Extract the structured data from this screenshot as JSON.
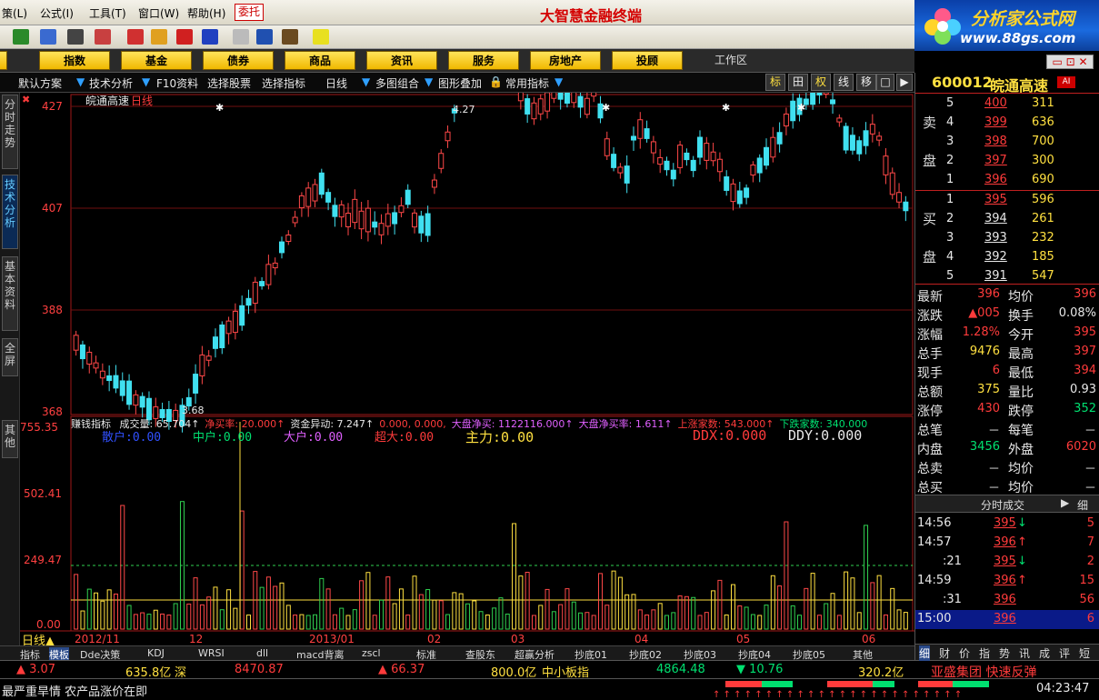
{
  "menus": [
    "策(L)",
    "公式(I)",
    "工具(T)",
    "窗口(W)",
    "帮助(H)"
  ],
  "weituo": "委托",
  "app_title": "大智慧金融终端",
  "logo": {
    "line1": "分析家公式网",
    "line2": "www.88gs.com"
  },
  "categories": [
    "票",
    "指数",
    "基金",
    "债券",
    "商品",
    "资讯",
    "服务",
    "房地产",
    "投顾"
  ],
  "workarea": "工作区",
  "controls": [
    "默认方案",
    "技术分析",
    "F10资料",
    "选择股票",
    "选择指标",
    "日线",
    "多图组合",
    "图形叠加",
    "常用指标"
  ],
  "ctrl_buttons": [
    "标",
    "田",
    "权",
    "线",
    "移",
    "□",
    "▶"
  ],
  "side_tabs": [
    "分时走势",
    "技术分析",
    "基本资料",
    "全屏",
    "其他"
  ],
  "chart": {
    "stock": "皖通高速",
    "period": "日线",
    "price_labels": [
      "427",
      "407",
      "388",
      "368"
    ],
    "high_mark": "4.27",
    "low_mark": "3.68",
    "ind_name": "赚钱指标",
    "ind_items": [
      {
        "t": "成交量: 65.704↑",
        "c": "#e8e8e8"
      },
      {
        "t": "净买率: 20.000↑",
        "c": "#ff3b3b"
      },
      {
        "t": "资金异动: 7.247↑",
        "c": "#e8e8e8"
      },
      {
        "t": "0.000, 0.000,",
        "c": "#ff3b3b"
      },
      {
        "t": "大盘净买: 1122116.000↑",
        "c": "#e060ff"
      },
      {
        "t": "大盘净买率: 1.611↑",
        "c": "#e060ff"
      },
      {
        "t": "上涨家数: 543.000↑",
        "c": "#ff3b3b"
      },
      {
        "t": "下跌家数: 340.000",
        "c": "#00e070"
      }
    ],
    "vol_labels": [
      "755.35",
      "502.41",
      "249.47",
      "0.00"
    ],
    "flows": [
      {
        "t": "散户:0.00",
        "c": "#3050ff"
      },
      {
        "t": "中户:0.00",
        "c": "#00e070"
      },
      {
        "t": "大户:0.00",
        "c": "#e060ff"
      },
      {
        "t": "超大:0.00",
        "c": "#ff3b3b"
      },
      {
        "t": "主力:0.00",
        "c": "#ffe040"
      },
      {
        "t": "DDX:0.000",
        "c": "#ff3b3b"
      },
      {
        "t": "DDY:0.000",
        "c": "#e8e8e8"
      }
    ],
    "dates": [
      "2012/11",
      "12",
      "2013/01",
      "02",
      "03",
      "04",
      "05",
      "06"
    ],
    "period_tag": "日线"
  },
  "bottom_tabs": [
    "指标",
    "模板",
    "Dde决策",
    "KDJ",
    "WRSI",
    "dll",
    "macd背离",
    "zscl",
    "标准",
    "查股东",
    "超赢分析",
    "抄底01",
    "抄底02",
    "抄底03",
    "抄底04",
    "抄底05",
    "其他"
  ],
  "ticker": [
    {
      "t": "▲ 3.07",
      "c": "#ff3b3b"
    },
    {
      "t": "635.8亿",
      "c": "#ffe040"
    },
    {
      "t": "深",
      "c": "#ffe040"
    },
    {
      "t": "8470.87",
      "c": "#ff3b3b"
    },
    {
      "t": "▲ 66.37",
      "c": "#ff3b3b"
    },
    {
      "t": "800.0亿",
      "c": "#ffe040"
    },
    {
      "t": "中小板指",
      "c": "#ffe040"
    },
    {
      "t": "4864.48",
      "c": "#00e070"
    },
    {
      "t": "▼ 10.76",
      "c": "#00e070"
    },
    {
      "t": "320.2亿",
      "c": "#ffe040"
    },
    {
      "t": "亚盛集团 快速反弹",
      "c": "#ff3b3b"
    }
  ],
  "status": {
    "news": "最严重旱情 农产品涨价在即",
    "time": "04:23:47"
  },
  "quote": {
    "code": "600012",
    "name": "皖通高速",
    "sell": [
      [
        "5",
        "400",
        "311"
      ],
      [
        "4",
        "399",
        "636"
      ],
      [
        "3",
        "398",
        "700"
      ],
      [
        "2",
        "397",
        "300"
      ],
      [
        "1",
        "396",
        "690"
      ]
    ],
    "buy": [
      [
        "1",
        "395",
        "596"
      ],
      [
        "2",
        "394",
        "261"
      ],
      [
        "3",
        "393",
        "232"
      ],
      [
        "4",
        "392",
        "185"
      ],
      [
        "5",
        "391",
        "547"
      ]
    ],
    "sell_label": [
      "卖",
      "盘"
    ],
    "buy_label": [
      "买",
      "盘"
    ],
    "stats": [
      [
        "最新",
        "396",
        "均价",
        "396",
        "red",
        "red"
      ],
      [
        "涨跌",
        "▲005",
        "换手",
        "0.08%",
        "red",
        "wht"
      ],
      [
        "涨幅",
        "1.28%",
        "今开",
        "395",
        "red",
        "red"
      ],
      [
        "总手",
        "9476",
        "最高",
        "397",
        "yel",
        "red"
      ],
      [
        "现手",
        "6",
        "最低",
        "394",
        "red",
        "red"
      ],
      [
        "总额",
        "375",
        "量比",
        "0.93",
        "yel",
        "wht"
      ],
      [
        "涨停",
        "430",
        "跌停",
        "352",
        "red",
        "grn"
      ],
      [
        "总笔",
        "－",
        "每笔",
        "－",
        "wht",
        "wht"
      ],
      [
        "内盘",
        "3456",
        "外盘",
        "6020",
        "grn",
        "red"
      ],
      [
        "总卖",
        "－",
        "均价",
        "－",
        "wht",
        "wht"
      ],
      [
        "总买",
        "－",
        "均价",
        "－",
        "wht",
        "wht"
      ]
    ],
    "ticks_title": "分时成交",
    "ticks_btn": "细",
    "ticks": [
      [
        "14:56",
        "395",
        "↓",
        "5",
        "grn"
      ],
      [
        "14:57",
        "396",
        "↑",
        "7",
        "red"
      ],
      [
        ":21",
        "395",
        "↓",
        "2",
        "grn"
      ],
      [
        "14:59",
        "396",
        "↑",
        "15",
        "red"
      ],
      [
        ":31",
        "396",
        "",
        "56",
        "red"
      ],
      [
        "15:00",
        "396",
        "",
        "6",
        "red"
      ]
    ],
    "panel_tabs": [
      "细",
      "财",
      "价",
      "指",
      "势",
      "讯",
      "成",
      "评",
      "短"
    ]
  }
}
